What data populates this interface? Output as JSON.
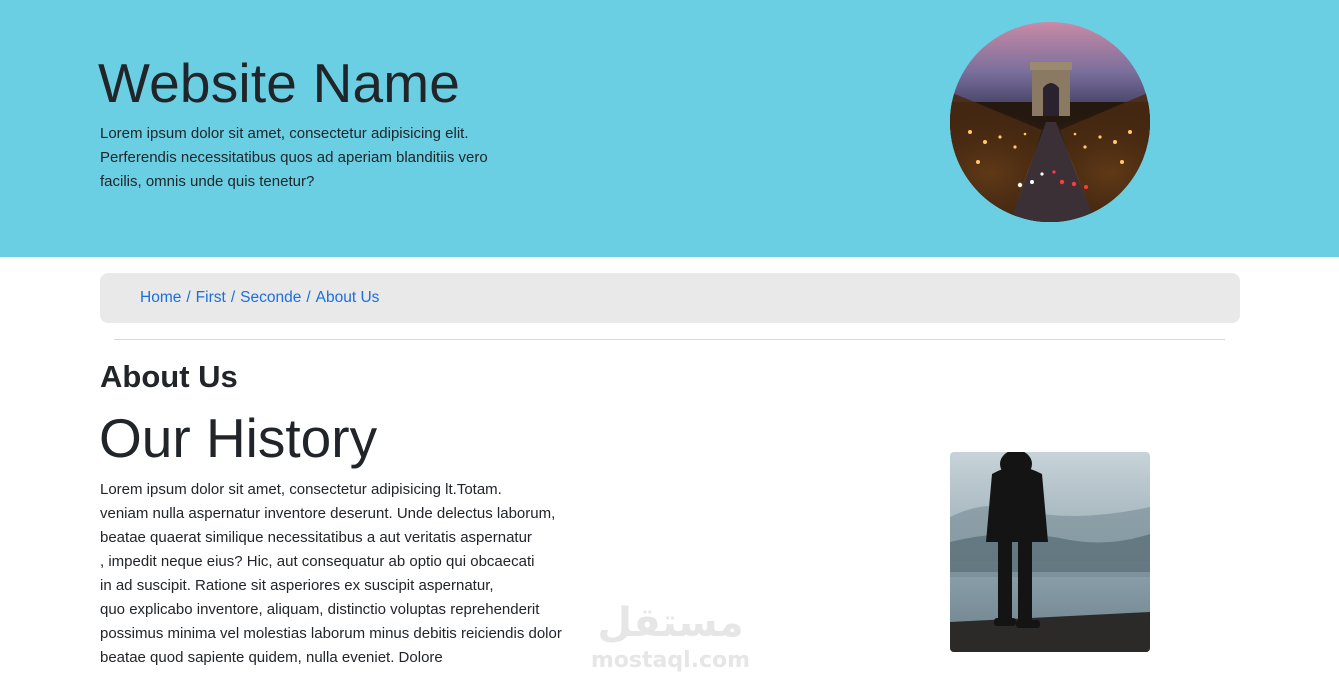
{
  "header": {
    "site_title": "Website Name",
    "lead": "Lorem ipsum dolor sit amet, consectetur adipisicing elit. Perferendis necessitatibus quos ad aperiam blanditiis vero facilis, omnis unde quis tenetur?"
  },
  "breadcrumb": {
    "items": [
      "Home",
      "First",
      "Seconde",
      "About Us"
    ],
    "separator": "/"
  },
  "main": {
    "section_title": "About Us",
    "history_title": "Our History",
    "history_lines": [
      "Lorem ipsum dolor sit amet, consectetur adipisicing lt.Totam.",
      "veniam nulla aspernatur inventore deserunt. Unde delectus laborum,",
      "beatae quaerat similique necessitatibus a aut veritatis aspernatur",
      ", impedit neque eius? Hic, aut consequatur ab optio qui obcaecati",
      "in ad suscipit. Ratione sit asperiores ex suscipit aspernatur,",
      "quo explicabo inventore, aliquam, distinctio voluptas reprehenderit",
      "possimus minima vel molestias laborum minus debitis reiciendis dolor",
      "beatae quod sapiente quidem, nulla eveniet. Dolore"
    ]
  },
  "watermark": {
    "arabic": "مستقل",
    "latin": "mostaql.com"
  },
  "colors": {
    "hero_bg": "#6bcfe4",
    "breadcrumb_bg": "#e9e9e9",
    "link": "#1a6fe0"
  }
}
